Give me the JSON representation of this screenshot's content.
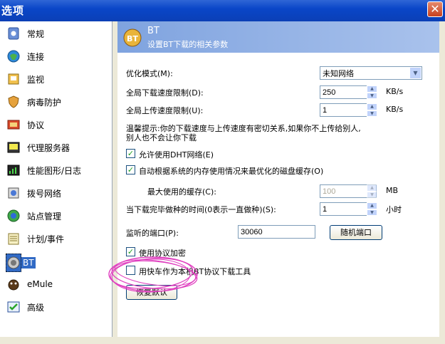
{
  "window": {
    "title": "选项"
  },
  "sidebar": {
    "items": [
      {
        "label": "常规",
        "icon": "general-icon"
      },
      {
        "label": "连接",
        "icon": "connection-icon"
      },
      {
        "label": "监视",
        "icon": "monitor-icon"
      },
      {
        "label": "病毒防护",
        "icon": "virus-protection-icon"
      },
      {
        "label": "协议",
        "icon": "protocol-icon"
      },
      {
        "label": "代理服务器",
        "icon": "proxy-server-icon"
      },
      {
        "label": "性能图形/日志",
        "icon": "performance-graph-icon"
      },
      {
        "label": "拨号网络",
        "icon": "dialup-icon"
      },
      {
        "label": "站点管理",
        "icon": "site-manager-icon"
      },
      {
        "label": "计划/事件",
        "icon": "schedule-icon"
      },
      {
        "label": "BT",
        "icon": "bt-icon"
      },
      {
        "label": "eMule",
        "icon": "emule-icon"
      },
      {
        "label": "高级",
        "icon": "advanced-icon"
      }
    ],
    "selected": "BT"
  },
  "header": {
    "title": "BT",
    "subtitle": "设置BT下载的相关参数",
    "icon_text": "BT"
  },
  "form": {
    "optimize_label": "优化模式(M):",
    "optimize_value": "未知网络",
    "download_limit_label": "全局下载速度限制(D):",
    "download_limit_value": "250",
    "upload_limit_label": "全局上传速度限制(U):",
    "upload_limit_value": "1",
    "unit_kbs": "KB/s",
    "tip_line1": "温馨提示:你的下载速度与上传速度有密切关系,如果你不上传给别人,",
    "tip_line2": "别人也不会让你下载",
    "dht_label": "允许使用DHT网络(E)",
    "dht_checked": true,
    "auto_cache_label": "自动根据系统的内存使用情况来最优化的磁盘缓存(O)",
    "auto_cache_checked": true,
    "max_cache_label": "最大使用的缓存(C):",
    "max_cache_value": "100",
    "unit_mb": "MB",
    "seed_time_label": "当下载完毕做种的时间(0表示一直做种)(S):",
    "seed_time_value": "1",
    "unit_hours": "小时",
    "port_label": "监听的端口(P):",
    "port_value": "30060",
    "random_port_button": "随机端口",
    "encryption_label": "使用协议加密",
    "encryption_checked": true,
    "default_tool_label": "用快车作为本机BT协议下载工具",
    "default_tool_checked": false,
    "restore_default_button": "恢复默认"
  }
}
